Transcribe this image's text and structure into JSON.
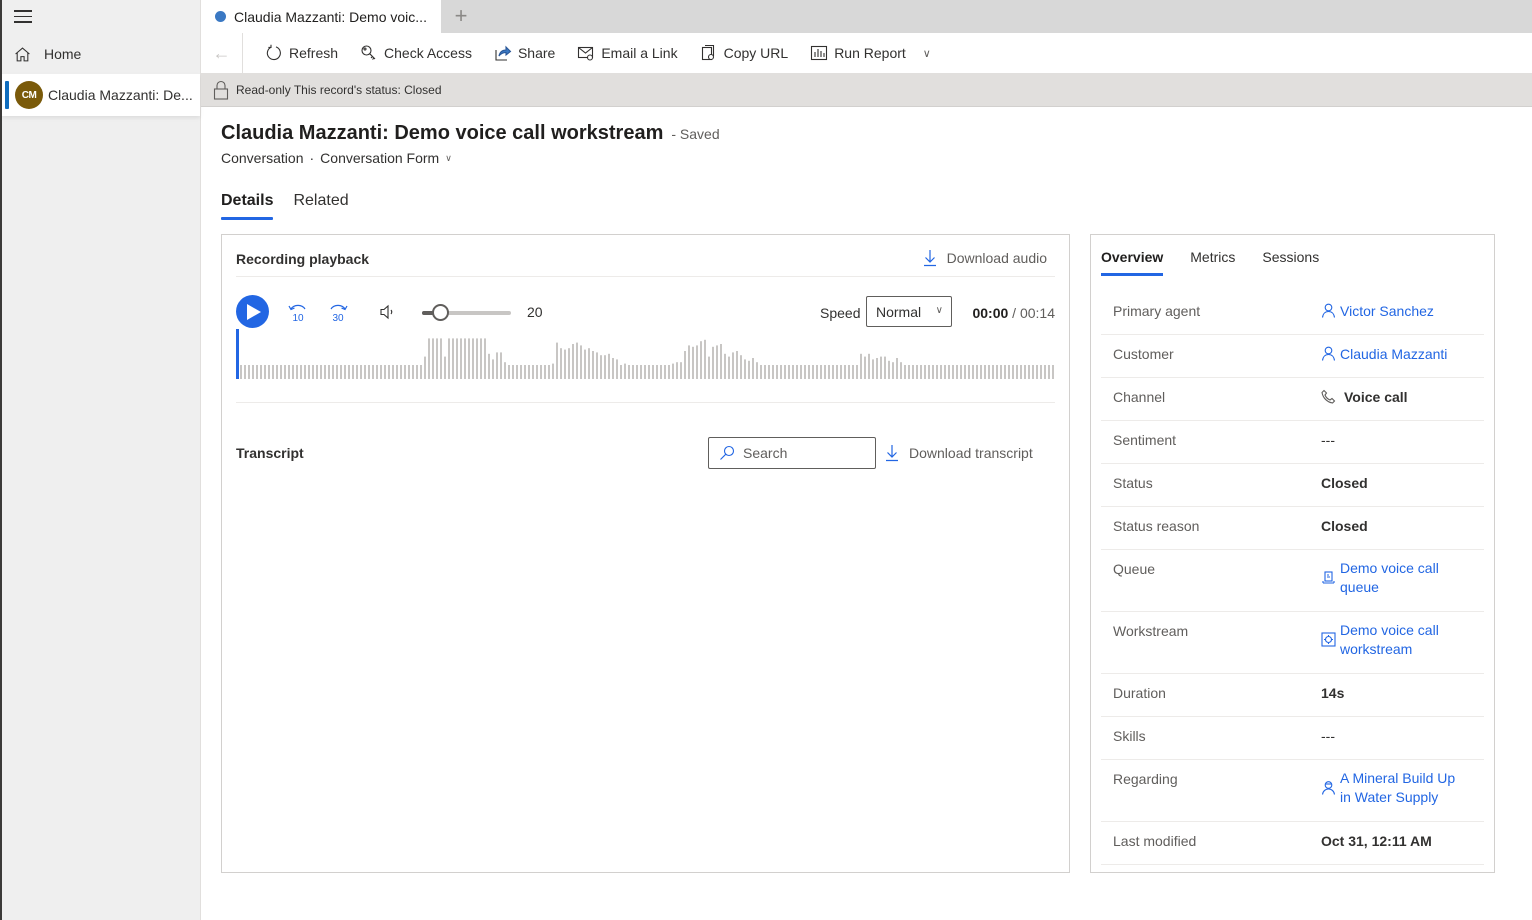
{
  "nav": {
    "home_label": "Home",
    "session": {
      "initials": "CM",
      "label": "Claudia Mazzanti: De...",
      "avatar_color": "#7a5a0a"
    }
  },
  "tabs": {
    "active_label": "Claudia Mazzanti: Demo voic...",
    "add_label": "+"
  },
  "commands": {
    "back": "←",
    "refresh": "Refresh",
    "check_access": "Check Access",
    "share": "Share",
    "email_link": "Email a Link",
    "copy_url": "Copy URL",
    "run_report": "Run Report"
  },
  "readonly_bar": {
    "text": "Read-only This record's status: Closed"
  },
  "record": {
    "title": "Claudia Mazzanti: Demo voice call workstream",
    "save_status": "- Saved",
    "entity": "Conversation",
    "separator": "·",
    "form": "Conversation Form"
  },
  "form_tabs": [
    {
      "label": "Details",
      "active": true
    },
    {
      "label": "Related",
      "active": false
    }
  ],
  "recording": {
    "title": "Recording playback",
    "download_audio": "Download audio",
    "skip_back": "10",
    "skip_forward": "30",
    "volume_value": "20",
    "volume_fraction": 0.2,
    "speed_label": "Speed",
    "speed_value": "Normal",
    "current_time": "00:00",
    "total_time": "/ 00:14",
    "playhead_fraction": 0,
    "waveform_levels": [
      1,
      1,
      1,
      1,
      1,
      1,
      1,
      1,
      1,
      1,
      1,
      1,
      1,
      1,
      1,
      1,
      1,
      1,
      1,
      1,
      1,
      1,
      1,
      1,
      1,
      1,
      1,
      1,
      1,
      1,
      1,
      1,
      1,
      1,
      1,
      1,
      1,
      1,
      1,
      1,
      1,
      1,
      1,
      1,
      1,
      1,
      1.6,
      2.9,
      2.9,
      2.9,
      2.9,
      1.6,
      2.9,
      2.9,
      2.9,
      2.9,
      2.9,
      2.9,
      2.9,
      2.9,
      2.9,
      2.9,
      1.8,
      1.4,
      1.9,
      1.9,
      1.2,
      1,
      1,
      1,
      1,
      1,
      1,
      1,
      1,
      1,
      1,
      1,
      1.1,
      2.6,
      2.2,
      2.1,
      2.2,
      2.5,
      2.6,
      2.4,
      2.1,
      2.2,
      2.0,
      1.9,
      1.7,
      1.7,
      1.8,
      1.5,
      1.4,
      1,
      1.1,
      1,
      1,
      1,
      1,
      1,
      1,
      1,
      1,
      1,
      1,
      1,
      1.1,
      1.2,
      1.2,
      2.0,
      2.4,
      2.3,
      2.4,
      2.7,
      2.8,
      1.6,
      2.3,
      2.4,
      2.5,
      1.8,
      1.6,
      1.9,
      2.0,
      1.7,
      1.4,
      1.3,
      1.5,
      1.2,
      1,
      1,
      1,
      1,
      1,
      1,
      1,
      1,
      1,
      1,
      1,
      1,
      1,
      1,
      1,
      1,
      1,
      1,
      1,
      1,
      1,
      1,
      1,
      1,
      1,
      1.8,
      1.6,
      1.8,
      1.4,
      1.5,
      1.6,
      1.6,
      1.3,
      1.2,
      1.5,
      1.2,
      1,
      1,
      1,
      1,
      1,
      1,
      1,
      1,
      1,
      1,
      1,
      1,
      1,
      1,
      1,
      1,
      1,
      1,
      1,
      1,
      1,
      1,
      1,
      1,
      1,
      1,
      1,
      1,
      1,
      1,
      1,
      1,
      1,
      1,
      1,
      1,
      1,
      1,
      1,
      1,
      1,
      1,
      1,
      1,
      1,
      1,
      1,
      1,
      1,
      1,
      1,
      1,
      1,
      1,
      1,
      1,
      1
    ],
    "waveform_color": "#c8c6c4",
    "accent_color": "#2266e3"
  },
  "transcript": {
    "title": "Transcript",
    "search_placeholder": "Search",
    "download_transcript": "Download transcript"
  },
  "side_panel": {
    "tabs": [
      {
        "label": "Overview",
        "active": true
      },
      {
        "label": "Metrics",
        "active": false
      },
      {
        "label": "Sessions",
        "active": false
      }
    ],
    "fields": [
      {
        "label": "Primary agent",
        "value": "Victor Sanchez",
        "type": "link",
        "icon": "person-icon"
      },
      {
        "label": "Customer",
        "value": "Claudia Mazzanti",
        "type": "link",
        "icon": "person-icon"
      },
      {
        "label": "Channel",
        "value": "Voice call",
        "type": "text",
        "icon": "phone-icon"
      },
      {
        "label": "Sentiment",
        "value": "---",
        "type": "dash"
      },
      {
        "label": "Status",
        "value": "Closed",
        "type": "text"
      },
      {
        "label": "Status reason",
        "value": "Closed",
        "type": "text"
      },
      {
        "label": "Queue",
        "value": "Demo voice call queue",
        "line1": "Demo voice call",
        "line2": "queue",
        "type": "link2",
        "icon": "queue-icon"
      },
      {
        "label": "Workstream",
        "value": "Demo voice call workstream",
        "line1": "Demo voice call",
        "line2": "workstream",
        "type": "link2",
        "icon": "workstream-icon"
      },
      {
        "label": "Duration",
        "value": "14s",
        "type": "text"
      },
      {
        "label": "Skills",
        "value": "---",
        "type": "dash"
      },
      {
        "label": "Regarding",
        "value": "A Mineral Build Up in Water Supply",
        "line1": "A Mineral Build Up",
        "line2": "in Water Supply",
        "type": "link2",
        "icon": "case-icon"
      },
      {
        "label": "Last modified",
        "value": "Oct 31, 12:11 AM",
        "type": "text"
      }
    ]
  }
}
